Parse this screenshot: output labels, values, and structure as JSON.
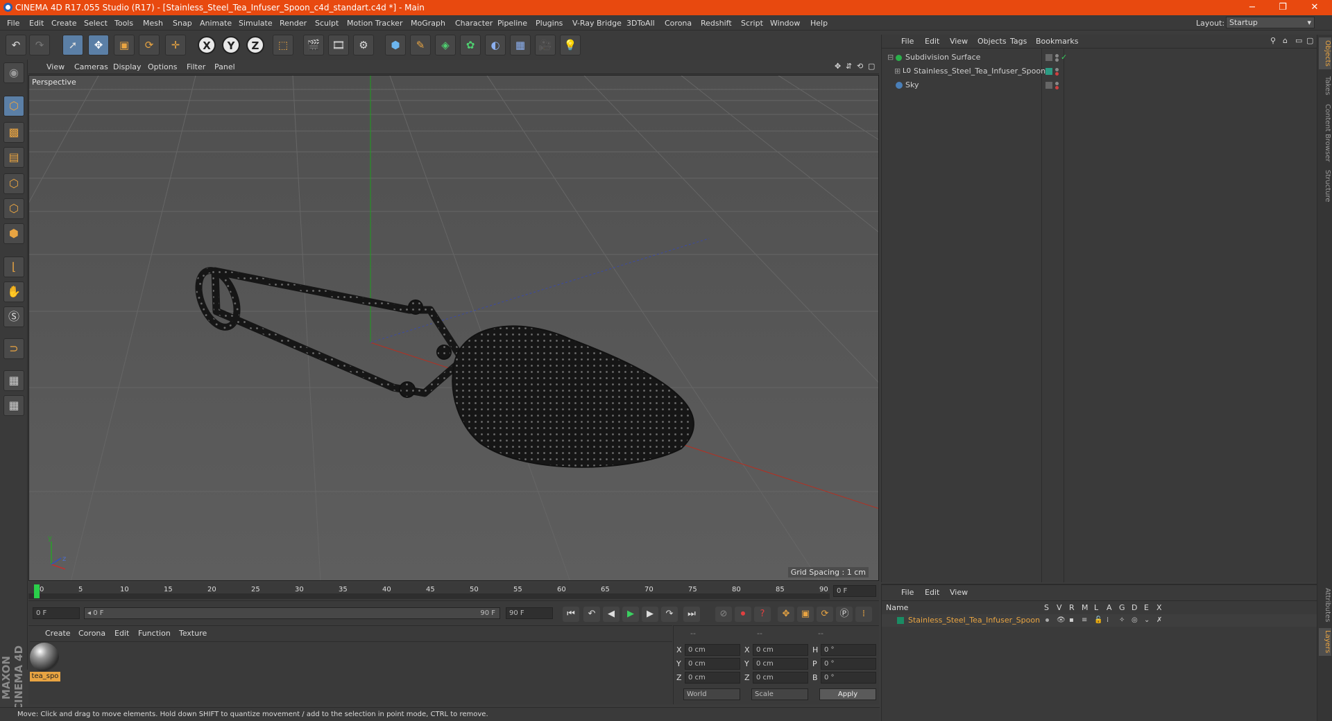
{
  "window": {
    "title": "CINEMA 4D R17.055 Studio (R17) - [Stainless_Steel_Tea_Infuser_Spoon_c4d_standart.c4d *] - Main",
    "minimize": "−",
    "maximize": "❐",
    "close": "✕"
  },
  "menu": [
    "File",
    "Edit",
    "Create",
    "Select",
    "Tools",
    "Mesh",
    "Snap",
    "Animate",
    "Simulate",
    "Render",
    "Sculpt",
    "Motion Tracker",
    "MoGraph",
    "Character",
    "Pipeline",
    "Plugins",
    "V-Ray Bridge",
    "3DToAll",
    "Corona",
    "Redshift",
    "Script",
    "Window",
    "Help"
  ],
  "layout": {
    "label": "Layout:",
    "value": "Startup"
  },
  "toolbar": {
    "undo": "↶",
    "redo": "↷",
    "select": "➚",
    "move": "✥",
    "scale": "▣",
    "rotate": "⟳",
    "live": "✛",
    "x": "X",
    "y": "Y",
    "z": "Z",
    "coord": "⬚"
  },
  "viewport": {
    "menu": [
      "View",
      "Cameras",
      "Display",
      "Options",
      "Filter",
      "Panel"
    ],
    "label": "Perspective",
    "grid_spacing": "Grid Spacing : 1 cm",
    "axis_y": "y",
    "axis_z": "z"
  },
  "timeline": {
    "ticks": [
      "0",
      "5",
      "10",
      "15",
      "20",
      "25",
      "30",
      "35",
      "40",
      "45",
      "50",
      "55",
      "60",
      "65",
      "70",
      "75",
      "80",
      "85",
      "90"
    ],
    "current_frame": "0 F",
    "start_field": "0 F",
    "range_left": "◂ 0 F",
    "range_right": "90 F",
    "end_field": "90 F",
    "end_frame_right": "0 F"
  },
  "material_panel": {
    "menu": [
      "Create",
      "Corona",
      "Edit",
      "Function",
      "Texture"
    ],
    "material_name": "tea_spo"
  },
  "coords": {
    "header": [
      "--",
      "--",
      "--"
    ],
    "rows": [
      {
        "a": "X",
        "v1": "0 cm",
        "b": "X",
        "v2": "0 cm",
        "c": "H",
        "v3": "0 °"
      },
      {
        "a": "Y",
        "v1": "0 cm",
        "b": "Y",
        "v2": "0 cm",
        "c": "P",
        "v3": "0 °"
      },
      {
        "a": "Z",
        "v1": "0 cm",
        "b": "Z",
        "v2": "0 cm",
        "c": "B",
        "v3": "0 °"
      }
    ],
    "world": "World",
    "scale": "Scale",
    "apply": "Apply"
  },
  "status": "Move: Click and drag to move elements. Hold down SHIFT to quantize movement / add to the selection in point mode, CTRL to remove.",
  "objects_panel": {
    "menu": [
      "File",
      "Edit",
      "View",
      "Objects",
      "Tags",
      "Bookmarks"
    ],
    "items": [
      {
        "name": "Subdivision Surface",
        "color": "#2ab04a"
      },
      {
        "name": "Stainless_Steel_Tea_Infuser_Spoon",
        "color": "#2b9c84"
      },
      {
        "name": "Sky",
        "color": "#4a7fb8"
      }
    ]
  },
  "layers_panel": {
    "menu": [
      "File",
      "Edit",
      "View"
    ],
    "header_name": "Name",
    "columns": [
      "S",
      "V",
      "R",
      "M",
      "L",
      "A",
      "G",
      "D",
      "E",
      "X"
    ],
    "layer_name": "Stainless_Steel_Tea_Infuser_Spoon",
    "layer_color": "#1a8c64"
  },
  "right_tabs": [
    "Objects",
    "Takes",
    "Content Browser",
    "Structure",
    "Attributes",
    "Layers"
  ],
  "maxon_logo": "MAXON CINEMA 4D",
  "colors": {
    "accent": "#e8490f",
    "selection": "#e8a442",
    "axis_x": "#c03020",
    "axis_y": "#20a020"
  }
}
